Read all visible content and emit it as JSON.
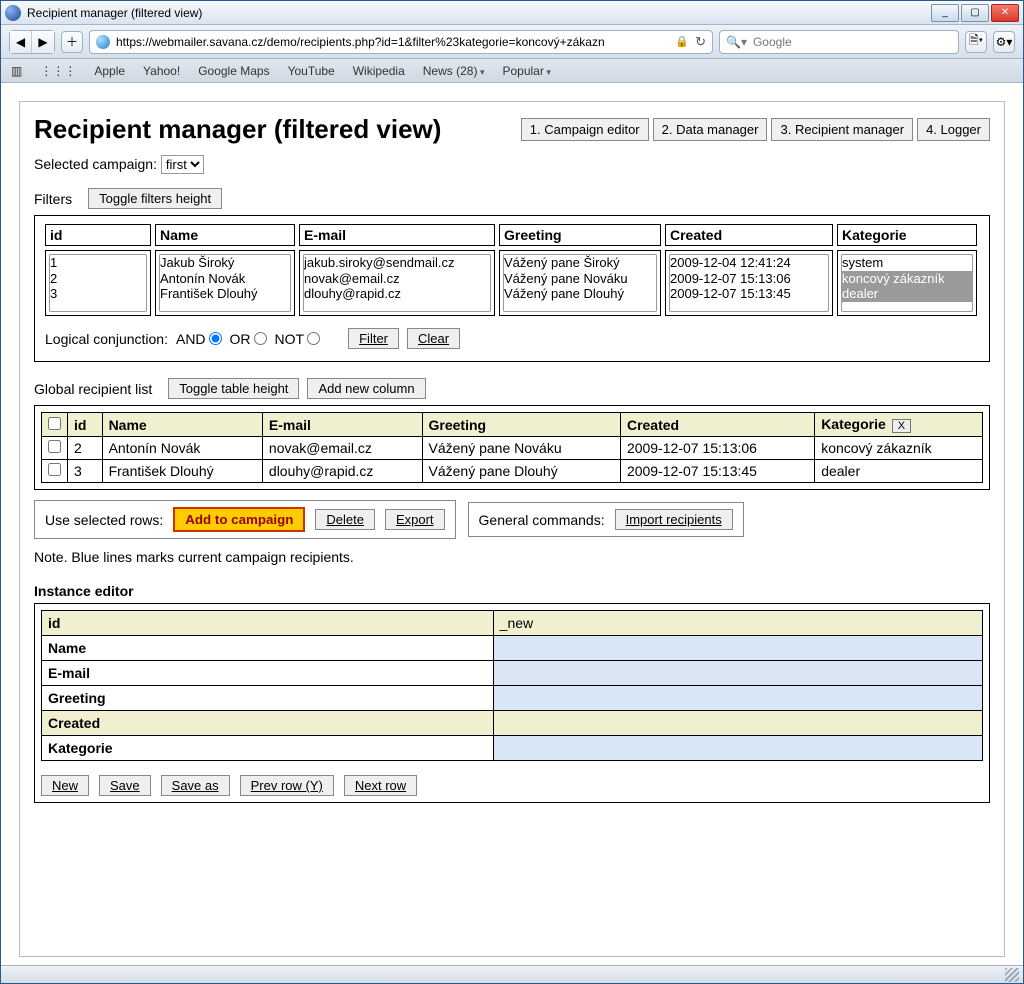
{
  "window": {
    "title": "Recipient manager (filtered view)"
  },
  "toolbar": {
    "url": "https://webmailer.savana.cz/demo/recipients.php?id=1&filter%23kategorie=koncový+zákazn",
    "search_placeholder": "Google"
  },
  "bookmarks": {
    "items": [
      "Apple",
      "Yahoo!",
      "Google Maps",
      "YouTube",
      "Wikipedia"
    ],
    "news": "News (28)",
    "popular": "Popular"
  },
  "page": {
    "heading": "Recipient manager (filtered view)",
    "nav": {
      "b1": "1. Campaign editor",
      "b2": "2. Data manager",
      "b3": "3. Recipient manager",
      "b4": "4. Logger"
    },
    "selected_campaign_label": "Selected campaign:",
    "selected_campaign_value": "first",
    "filters": {
      "label": "Filters",
      "toggle": "Toggle filters height",
      "headers": {
        "id": "id",
        "name": "Name",
        "email": "E-mail",
        "greeting": "Greeting",
        "created": "Created",
        "kategorie": "Kategorie"
      },
      "id_options": [
        "1",
        "2",
        "3"
      ],
      "name_options": [
        "Jakub Široký",
        "Antonín Novák",
        "František Dlouhý"
      ],
      "email_options": [
        "jakub.siroky@sendmail.cz",
        "novak@email.cz",
        "dlouhy@rapid.cz"
      ],
      "greeting_options": [
        "Vážený pane Široký",
        "Vážený pane Nováku",
        "Vážený pane Dlouhý"
      ],
      "created_options": [
        "2009-12-04 12:41:24",
        "2009-12-07 15:13:06",
        "2009-12-07 15:13:45"
      ],
      "kategorie_options": [
        "system",
        "koncový zákazník",
        "dealer"
      ],
      "logic_label": "Logical conjunction:",
      "logic_and": "AND",
      "logic_or": "OR",
      "logic_not": "NOT",
      "filter_btn": "Filter",
      "clear_btn": "Clear"
    },
    "list": {
      "label": "Global recipient list",
      "toggle": "Toggle table height",
      "addcol": "Add new column",
      "headers": {
        "id": "id",
        "name": "Name",
        "email": "E-mail",
        "greeting": "Greeting",
        "created": "Created",
        "kategorie": "Kategorie",
        "x": "X"
      },
      "rows": [
        {
          "id": "2",
          "name": "Antonín Novák",
          "email": "novak@email.cz",
          "greeting": "Vážený pane Nováku",
          "created": "2009-12-07 15:13:06",
          "kategorie": "koncový zákazník"
        },
        {
          "id": "3",
          "name": "František Dlouhý",
          "email": "dlouhy@rapid.cz",
          "greeting": "Vážený pane Dlouhý",
          "created": "2009-12-07 15:13:45",
          "kategorie": "dealer"
        }
      ],
      "use_label": "Use selected rows:",
      "add_btn": "Add to campaign",
      "delete_btn": "Delete",
      "export_btn": "Export",
      "general_label": "General commands:",
      "import_btn": "Import recipients",
      "note": "Note. Blue lines marks current campaign recipients."
    },
    "instance": {
      "heading": "Instance editor",
      "fields": {
        "id": "id",
        "name": "Name",
        "email": "E-mail",
        "greeting": "Greeting",
        "created": "Created",
        "kategorie": "Kategorie"
      },
      "id_value": "_new",
      "btns": {
        "new": "New",
        "save": "Save",
        "saveas": "Save as",
        "prev": "Prev row (Y)",
        "next": "Next row"
      }
    }
  }
}
